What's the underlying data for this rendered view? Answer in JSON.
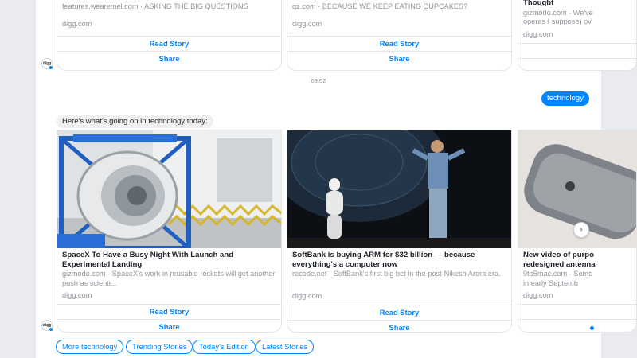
{
  "top_cards": [
    {
      "desc": "features.wearemel.com · ASKING THE BIG QUESTIONS",
      "domain": "digg.com",
      "read_label": "Read Story",
      "share_label": "Share"
    },
    {
      "desc": "qz.com · BECAUSE WE KEEP EATING CUPCAKES?",
      "domain": "digg.com",
      "read_label": "Read Story",
      "share_label": "Share"
    },
    {
      "title": "Thought",
      "desc": "gizmodo.com · We've\noperas I suppose) ov",
      "domain": "digg.com"
    }
  ],
  "timestamp": "09:02",
  "user_message": "technology",
  "bot_message": "Here's what's going on in technology today:",
  "avatar_label": "digg",
  "main_cards": [
    {
      "title": "SpaceX To Have a Busy Night With Launch and Experimental Landing",
      "desc": "gizmodo.com · SpaceX's work in reusable rockets will get another push as scienti...",
      "domain": "digg.com",
      "read_label": "Read Story",
      "share_label": "Share"
    },
    {
      "title": "SoftBank is buying ARM for $32 billion — because everything's a computer now",
      "desc": "recode.net · SoftBank's first big bet in the post-Nikesh Arora era.",
      "domain": "digg.com",
      "read_label": "Read Story",
      "share_label": "Share"
    },
    {
      "title": "New video of purpo\nredesigned antenna",
      "desc": "9to5mac.com · Some\nin early Septemb",
      "domain": "digg.com"
    }
  ],
  "next_arrow": "›",
  "quick_replies": [
    "More technology",
    "Trending Stories",
    "Today's Edition",
    "Latest Stories"
  ],
  "colors": {
    "accent": "#0084ff",
    "background": "#e9ebee",
    "bubble_bot": "#f1f0f0"
  }
}
